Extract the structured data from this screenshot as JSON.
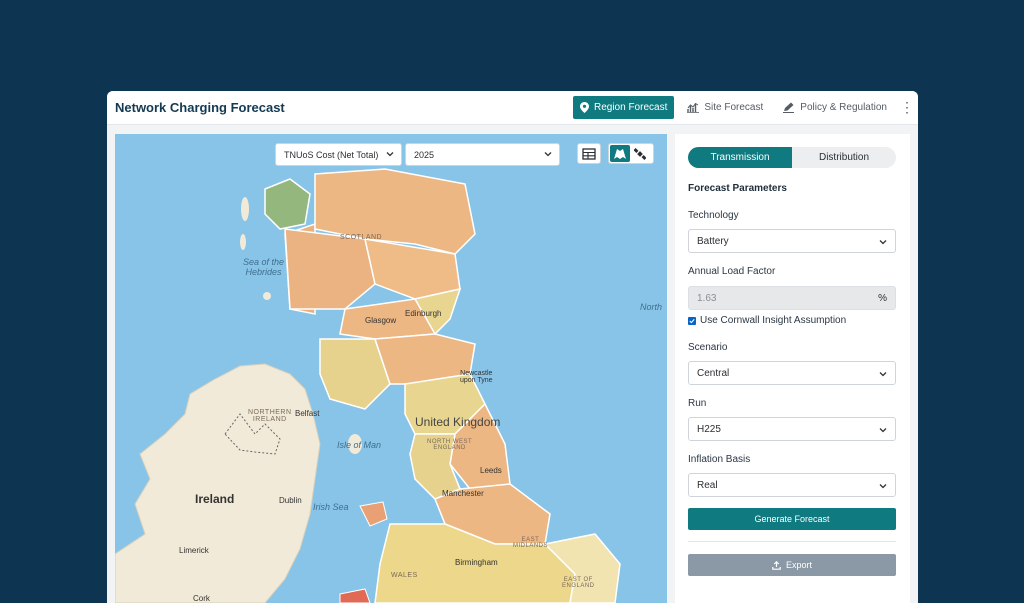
{
  "app": {
    "title": "Network Charging Forecast"
  },
  "nav": {
    "items": [
      {
        "label": "Region Forecast",
        "icon": "map-pin-icon",
        "active": true
      },
      {
        "label": "Site Forecast",
        "icon": "chart-icon",
        "active": false
      },
      {
        "label": "Policy & Regulation",
        "icon": "pen-icon",
        "active": false
      }
    ],
    "more_icon": "kebab-menu-icon"
  },
  "map": {
    "metric_select": "TNUoS Cost (Net Total)",
    "year_select": "2025",
    "tools": [
      "table-icon",
      "map-layer-icon",
      "satellite-icon"
    ],
    "labels": {
      "sea_hebrides": "Sea of the\nHebrides",
      "scotland": "SCOTLAND",
      "glasgow": "Glasgow",
      "edinburgh": "Edinburgh",
      "north": "North",
      "newcastle": "Newcastle\nupon Tyne",
      "northern_ireland": "NORTHERN\nIRELAND",
      "belfast": "Belfast",
      "isle_of_man": "Isle of Man",
      "uk": "United Kingdom",
      "north_west": "NORTH WEST\nENGLAND",
      "leeds": "Leeds",
      "ireland": "Ireland",
      "dublin": "Dublin",
      "irish_sea": "Irish Sea",
      "manchester": "Manchester",
      "limerick": "Limerick",
      "east_midlands": "EAST\nMIDLANDS",
      "birmingham": "Birmingham",
      "wales": "WALES",
      "east_of_england": "EAST OF\nENGLAND",
      "cork": "Cork"
    },
    "colors": {
      "sea": "#88c4e8",
      "zone_orange": "#edb784",
      "zone_yellow": "#ecd78a",
      "zone_green": "#93b77c",
      "zone_red": "#e06a55",
      "land": "#f1ead8"
    }
  },
  "panel": {
    "tabs": [
      {
        "label": "Transmission",
        "active": true
      },
      {
        "label": "Distribution",
        "active": false
      }
    ],
    "section_title": "Forecast Parameters",
    "technology": {
      "label": "Technology",
      "value": "Battery"
    },
    "load_factor": {
      "label": "Annual Load Factor",
      "value": "1.63",
      "suffix": "%"
    },
    "cornwall": {
      "label": "Use Cornwall Insight Assumption",
      "checked": true
    },
    "scenario": {
      "label": "Scenario",
      "value": "Central"
    },
    "run": {
      "label": "Run",
      "value": "H225"
    },
    "inflation": {
      "label": "Inflation Basis",
      "value": "Real"
    },
    "generate_label": "Generate Forecast",
    "export_label": "Export",
    "accent": "#0f7a7f"
  }
}
